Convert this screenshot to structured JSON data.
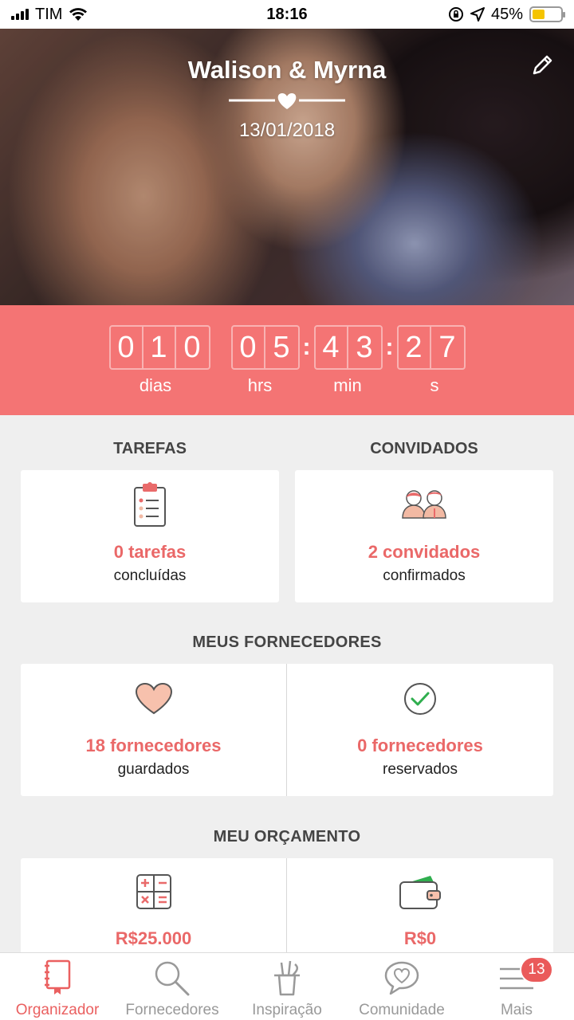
{
  "status_bar": {
    "carrier": "TIM",
    "time": "18:16",
    "battery": "45%",
    "battery_level": 0.45
  },
  "header": {
    "couple_name": "Walison & Myrna",
    "date": "13/01/2018"
  },
  "countdown": {
    "days": [
      "0",
      "1",
      "0"
    ],
    "hours": [
      "0",
      "5"
    ],
    "minutes": [
      "4",
      "3"
    ],
    "seconds": [
      "2",
      "7"
    ],
    "labels": {
      "days": "dias",
      "hours": "hrs",
      "minutes": "min",
      "seconds": "s"
    }
  },
  "tasks": {
    "title": "TAREFAS",
    "value": "0 tarefas",
    "sub": "concluídas"
  },
  "guests": {
    "title": "CONVIDADOS",
    "value": "2 convidados",
    "sub": "confirmados"
  },
  "vendors": {
    "title": "MEUS FORNECEDORES",
    "saved": {
      "value": "18 fornecedores",
      "sub": "guardados"
    },
    "booked": {
      "value": "0 fornecedores",
      "sub": "reservados"
    }
  },
  "budget": {
    "title": "MEU ORÇAMENTO",
    "estimated": {
      "value": "R$25.000"
    },
    "spent": {
      "value": "R$0"
    }
  },
  "tabs": [
    {
      "label": "Organizador",
      "icon": "notebook-icon",
      "active": true
    },
    {
      "label": "Fornecedores",
      "icon": "search-icon"
    },
    {
      "label": "Inspiração",
      "icon": "pencil-cup-icon"
    },
    {
      "label": "Comunidade",
      "icon": "chat-heart-icon"
    },
    {
      "label": "Mais",
      "icon": "menu-icon",
      "badge": "13"
    }
  ],
  "colors": {
    "accent": "#f47474",
    "value_text": "#ea6868",
    "active_tab": "#ea6060"
  }
}
